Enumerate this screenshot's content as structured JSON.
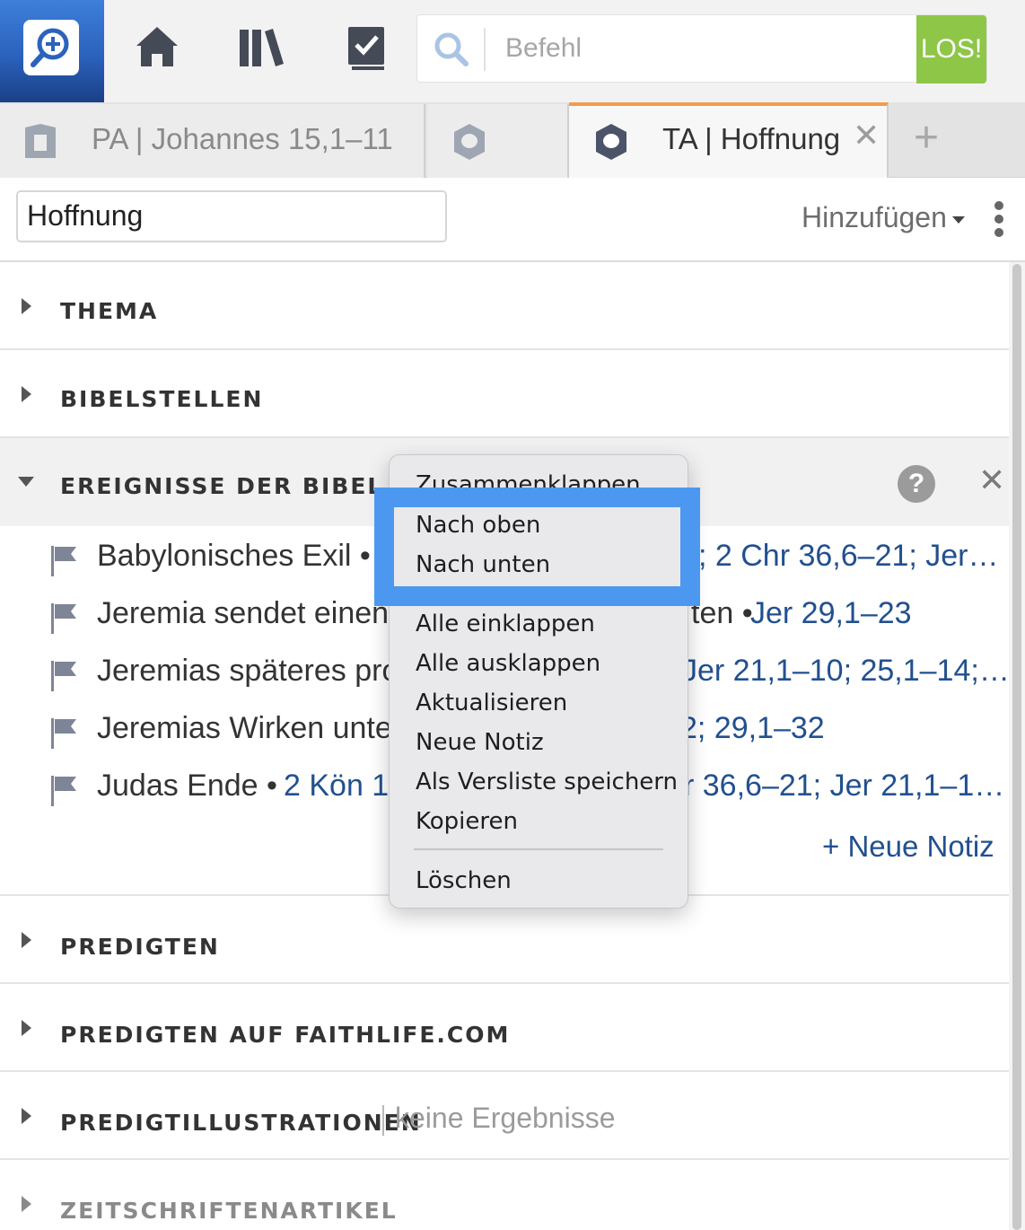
{
  "toolbar": {
    "search_placeholder": "Befehl",
    "go_label": "LOS!",
    "icons": [
      "app-logo-icon",
      "home-icon",
      "library-icon",
      "tasks-icon",
      "search-icon"
    ]
  },
  "tabs": [
    {
      "label": "PA | Johannes 15,1–11",
      "active": false
    },
    {
      "label": "",
      "active": false
    },
    {
      "label": "TA | Hoffnung",
      "active": true
    }
  ],
  "tab_close": "✕",
  "tab_add": "+",
  "title_row": {
    "title_value": "Hoffnung",
    "add_label": "Hinzufügen"
  },
  "sections": {
    "thema": "THEMA",
    "bibelstellen": "BIBELSTELLEN",
    "ereignisse": "EREIGNISSE DER BIBEL",
    "predigten": "PREDIGTEN",
    "predigten_faithlife": "PREDIGTEN AUF FAITHLIFE.COM",
    "predigtillustrationen": "PREDIGTILLUSTRATIONEN",
    "predigtillustrationen_status": "keine Ergebnisse",
    "zeitschriften": "ZEITSCHRIFTENARTIKEL"
  },
  "events": [
    {
      "left": "Babylonisches Exil •",
      "right": "; 2 Chr 36,6–21; Jer…"
    },
    {
      "left": "Jeremia sendet einen",
      "right_dark": "ten • ",
      "right": "Jer 29,1–23"
    },
    {
      "left": "Jeremias späteres pro",
      "right": "Jer 21,1–10; 25,1–14;…"
    },
    {
      "left": "Jeremias Wirken unte",
      "right": "2; 29,1–32"
    },
    {
      "left": "Judas Ende • ",
      "left_ref": "2 Kön 1,",
      "right": "r 36,6–21; Jer 21,1–1…"
    }
  ],
  "new_note": "+ Neue Notiz",
  "help_symbol": "?",
  "close_symbol": "✕",
  "context_menu": {
    "items": [
      "Zusammenklappen",
      "Nach oben",
      "Nach unten",
      "Alle einklappen",
      "Alle ausklappen",
      "Aktualisieren",
      "Neue Notiz",
      "Als Versliste speichern",
      "Kopieren",
      "Löschen"
    ]
  },
  "colors": {
    "accent_tab": "#f39c4f",
    "go_button": "#8ec647",
    "link": "#22508f",
    "highlight": "#4c98f0",
    "logo": "#2b62bd"
  }
}
